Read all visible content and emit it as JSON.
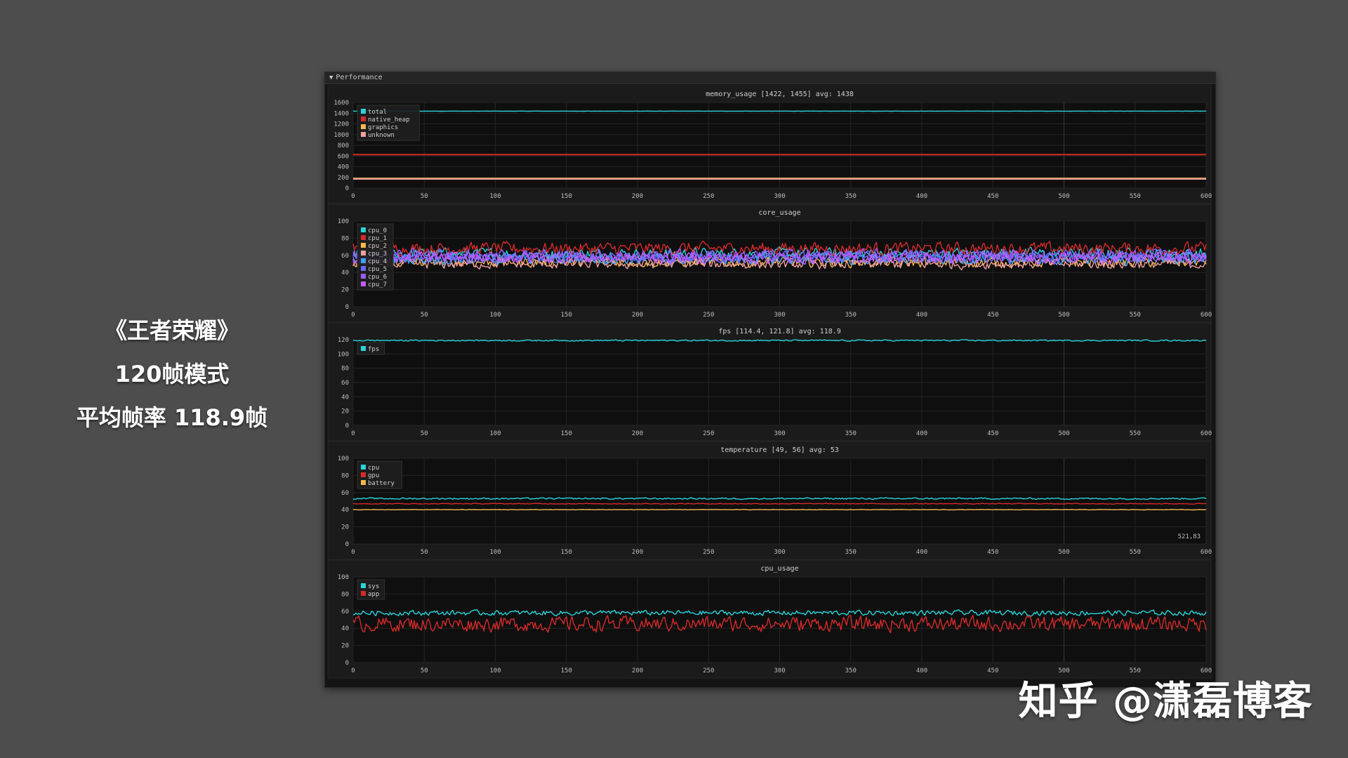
{
  "caption": {
    "line1": "《王者荣耀》",
    "line2": "120帧模式",
    "line3": "平均帧率 118.9帧"
  },
  "watermark": "知乎 @潇磊博客",
  "window": {
    "title": "Performance",
    "collapse_icon": "triangle-down-icon"
  },
  "chart_data": [
    {
      "type": "line",
      "title": "memory_usage [1422, 1455] avg: 1438",
      "xlim": [
        0,
        600
      ],
      "ylim": [
        0,
        1600
      ],
      "xticks": [
        0,
        50,
        100,
        150,
        200,
        250,
        300,
        350,
        400,
        450,
        500,
        550,
        600
      ],
      "yticks": [
        0,
        200,
        400,
        600,
        800,
        1000,
        1200,
        1400,
        1600
      ],
      "legend_position": "top-left",
      "series": [
        {
          "name": "total",
          "color": "#2ad3d9",
          "mean": 1438,
          "min": 1422,
          "max": 1455,
          "noise": 2
        },
        {
          "name": "native_heap",
          "color": "#d42a2a",
          "mean": 625,
          "noise": 0
        },
        {
          "name": "graphics",
          "color": "#f5b74f",
          "mean": 180,
          "noise": 0
        },
        {
          "name": "unknown",
          "color": "#f0a0a0",
          "mean": 170,
          "noise": 0
        }
      ]
    },
    {
      "type": "line",
      "title": "core_usage",
      "xlim": [
        0,
        600
      ],
      "ylim": [
        0,
        100
      ],
      "xticks": [
        0,
        50,
        100,
        150,
        200,
        250,
        300,
        350,
        400,
        450,
        500,
        550,
        600
      ],
      "yticks": [
        0,
        20,
        40,
        60,
        80,
        100
      ],
      "legend_position": "top-left",
      "series": [
        {
          "name": "cpu_0",
          "color": "#2ad3d9",
          "mean": 62,
          "noise": 9
        },
        {
          "name": "cpu_1",
          "color": "#d42a2a",
          "mean": 68,
          "noise": 10
        },
        {
          "name": "cpu_2",
          "color": "#f5b74f",
          "mean": 52,
          "noise": 8
        },
        {
          "name": "cpu_3",
          "color": "#f0a0a0",
          "mean": 50,
          "noise": 8
        },
        {
          "name": "cpu_4",
          "color": "#3fa0ff",
          "mean": 56,
          "noise": 9
        },
        {
          "name": "cpu_5",
          "color": "#6a6aff",
          "mean": 58,
          "noise": 9
        },
        {
          "name": "cpu_6",
          "color": "#9a5cff",
          "mean": 60,
          "noise": 10
        },
        {
          "name": "cpu_7",
          "color": "#c45cff",
          "mean": 57,
          "noise": 9
        }
      ]
    },
    {
      "type": "line",
      "title": "fps [114.4, 121.8] avg: 118.9",
      "xlim": [
        0,
        600
      ],
      "ylim": [
        0,
        120
      ],
      "xticks": [
        0,
        50,
        100,
        150,
        200,
        250,
        300,
        350,
        400,
        450,
        500,
        550,
        600
      ],
      "yticks": [
        0,
        20,
        40,
        60,
        80,
        100,
        120
      ],
      "legend_position": "top-left",
      "series": [
        {
          "name": "fps",
          "color": "#2ad3d9",
          "mean": 118.9,
          "min": 114.4,
          "max": 121.8,
          "noise": 1.2
        }
      ]
    },
    {
      "type": "line",
      "title": "temperature [49, 56] avg: 53",
      "xlim": [
        0,
        600
      ],
      "ylim": [
        0,
        100
      ],
      "xticks": [
        0,
        50,
        100,
        150,
        200,
        250,
        300,
        350,
        400,
        450,
        500,
        550,
        600
      ],
      "yticks": [
        0,
        20,
        40,
        60,
        80,
        100
      ],
      "legend_position": "top-left",
      "annotation": "521,83",
      "series": [
        {
          "name": "cpu",
          "color": "#2ad3d9",
          "mean": 53,
          "min": 49,
          "max": 56,
          "noise": 1.2
        },
        {
          "name": "gpu",
          "color": "#d42a2a",
          "mean": 47,
          "noise": 0.6
        },
        {
          "name": "battery",
          "color": "#f5b74f",
          "mean": 40,
          "noise": 0.3
        }
      ]
    },
    {
      "type": "line",
      "title": "cpu_usage",
      "xlim": [
        0,
        600
      ],
      "ylim": [
        0,
        100
      ],
      "xticks": [
        0,
        50,
        100,
        150,
        200,
        250,
        300,
        350,
        400,
        450,
        500,
        550,
        600
      ],
      "yticks": [
        0,
        20,
        40,
        60,
        80,
        100
      ],
      "legend_position": "top-left",
      "series": [
        {
          "name": "sys",
          "color": "#2ad3d9",
          "mean": 58,
          "noise": 4
        },
        {
          "name": "app",
          "color": "#d42a2a",
          "mean": 45,
          "noise": 12
        }
      ]
    }
  ]
}
